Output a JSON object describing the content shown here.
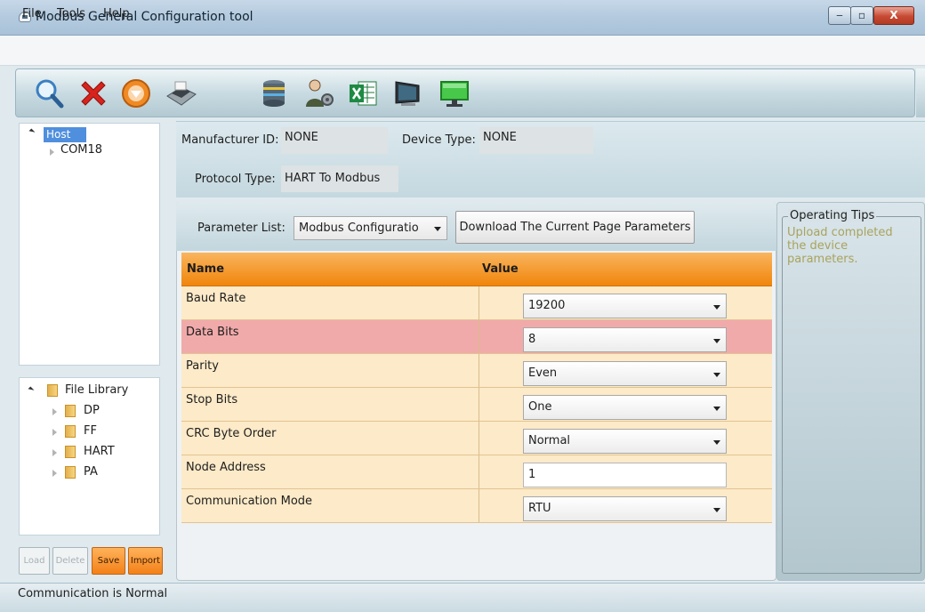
{
  "window": {
    "title": "Modbus General Configuration tool",
    "min_glyph": "‒",
    "max_glyph": "▫",
    "close_glyph": "X"
  },
  "menu": {
    "file": "File",
    "tools": "Tools",
    "help": "Help"
  },
  "toolbar": {
    "icons": [
      "search-icon",
      "close-icon",
      "download-icon",
      "printer-icon",
      "database-icon",
      "user-settings-icon",
      "excel-icon",
      "monitor-icon",
      "screen-icon"
    ]
  },
  "tree": {
    "host": "Host",
    "port": "COM18"
  },
  "file_library": {
    "title": "File Library",
    "folders": [
      "DP",
      "FF",
      "HART",
      "PA"
    ]
  },
  "actions": {
    "load": "Load",
    "delete": "Delete",
    "save": "Save",
    "import": "Import"
  },
  "device": {
    "manufacturer_label": "Manufacturer ID:",
    "manufacturer_value": "NONE",
    "device_type_label": "Device Type:",
    "device_type_value": "NONE",
    "protocol_label": "Protocol Type:",
    "protocol_value": "HART To Modbus"
  },
  "parameters": {
    "list_label": "Parameter List:",
    "list_value": "Modbus Configuratio",
    "download_label": "Download The Current Page Parameters",
    "col_name": "Name",
    "col_value": "Value",
    "rows": [
      {
        "name": "Baud Rate",
        "value": "19200"
      },
      {
        "name": "Data Bits",
        "value": "8"
      },
      {
        "name": "Parity",
        "value": "Even"
      },
      {
        "name": "Stop Bits",
        "value": "One"
      },
      {
        "name": "CRC Byte Order",
        "value": "Normal"
      },
      {
        "name": "Node Address",
        "value": "1"
      },
      {
        "name": "Communication Mode",
        "value": "RTU"
      }
    ]
  },
  "tips": {
    "title": "Operating Tips",
    "text": "Upload completed the device parameters."
  },
  "status": {
    "text": "Communication is Normal"
  },
  "colors": {
    "header_orange": "#f0850b",
    "row_bg": "#fceac8",
    "row_selected": "#f1aaaa",
    "tips_text": "#a9a35d"
  }
}
